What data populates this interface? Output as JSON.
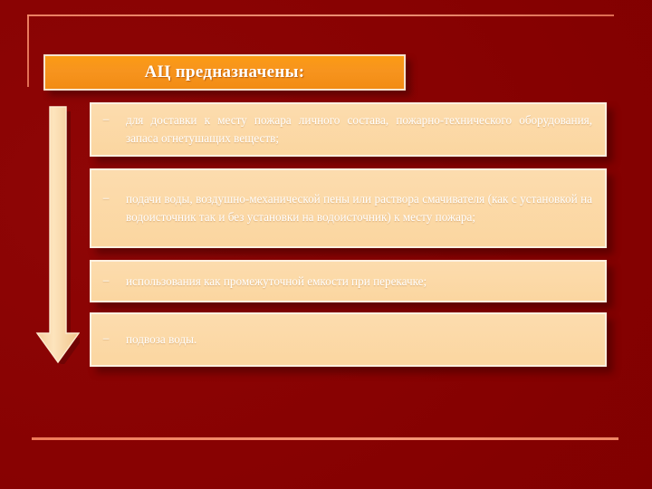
{
  "slide": {
    "background_color": "#8a0303",
    "accent_color": "#f7941e",
    "panel_color": "#fbd9a7",
    "rule_color": "#f08565"
  },
  "decor": {
    "top_rule_name": "top-horizontal-rule",
    "left_rule_name": "top-left-vertical-rule",
    "bottom_rule_name": "bottom-horizontal-rule",
    "arrow_label": "down-arrow"
  },
  "title": {
    "text": "АЦ предназначены:"
  },
  "bullets": [
    {
      "marker": "−",
      "text": "для доставки к месту пожара личного состава, пожарно-технического оборудования, запаса огнетушащих веществ;"
    },
    {
      "marker": "−",
      "text": "подачи воды, воздушно-механической пены или раствора смачивателя (как с установкой на водоисточник так и без установки на водоисточник) к месту пожара;"
    },
    {
      "marker": "−",
      "text": "использования как промежуточной емкости при перекачке;"
    },
    {
      "marker": "−",
      "text": "подвоза воды."
    }
  ]
}
